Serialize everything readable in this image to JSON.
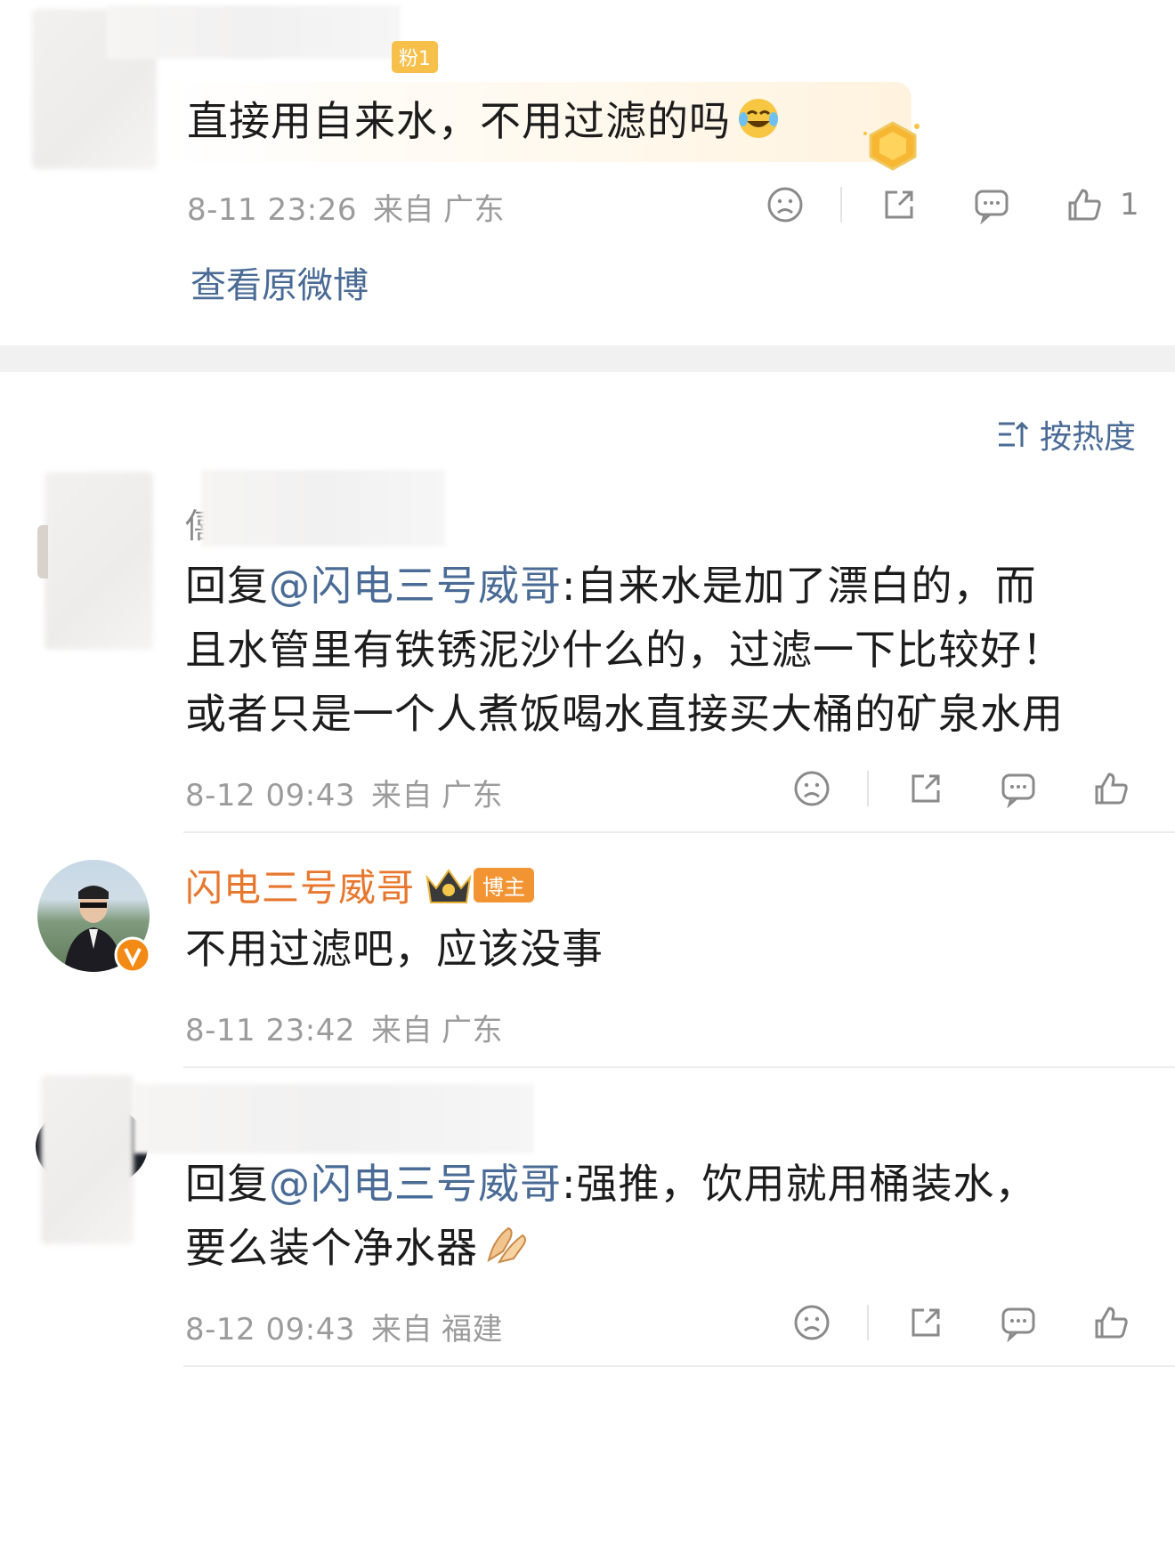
{
  "comment_top": {
    "badge_text": "粉1",
    "text": "直接用自来水，不用过滤的吗",
    "time": "8-11 23:26",
    "from": "来自",
    "location": "广东",
    "like_count": "1",
    "view_original": "查看原微博"
  },
  "sort": {
    "label": "按热度"
  },
  "replies": [
    {
      "name_partial": "僖",
      "reply_prefix": "回复",
      "mention": "@闪电三号威哥",
      "text_line1": ":自来水是加了漂白的，而",
      "text_line2": "且水管里有铁锈泥沙什么的，过滤一下比较好！",
      "text_line3": "或者只是一个人煮饭喝水直接买大桶的矿泉水用",
      "time": "8-12 09:43",
      "from": "来自",
      "location": "广东"
    },
    {
      "name": "闪电三号威哥",
      "badge": "博主",
      "text": "不用过滤吧，应该没事",
      "time": "8-11 23:42",
      "from": "来自",
      "location": "广东"
    },
    {
      "reply_prefix": "回复",
      "mention": "@闪电三号威哥",
      "text_line1": ":强推，饮用就用桶装水，",
      "text_line2": "要么装个净水器",
      "time": "8-12 09:43",
      "from": "来自",
      "location": "福建"
    }
  ],
  "icons": {
    "dislike": "sad-face-icon",
    "share": "share-icon",
    "comment": "comment-icon",
    "like": "thumbs-up-icon"
  },
  "colors": {
    "accent_blue": "#4a6b95",
    "author_orange": "#e8772e",
    "meta_gray": "#9b9b9b"
  }
}
